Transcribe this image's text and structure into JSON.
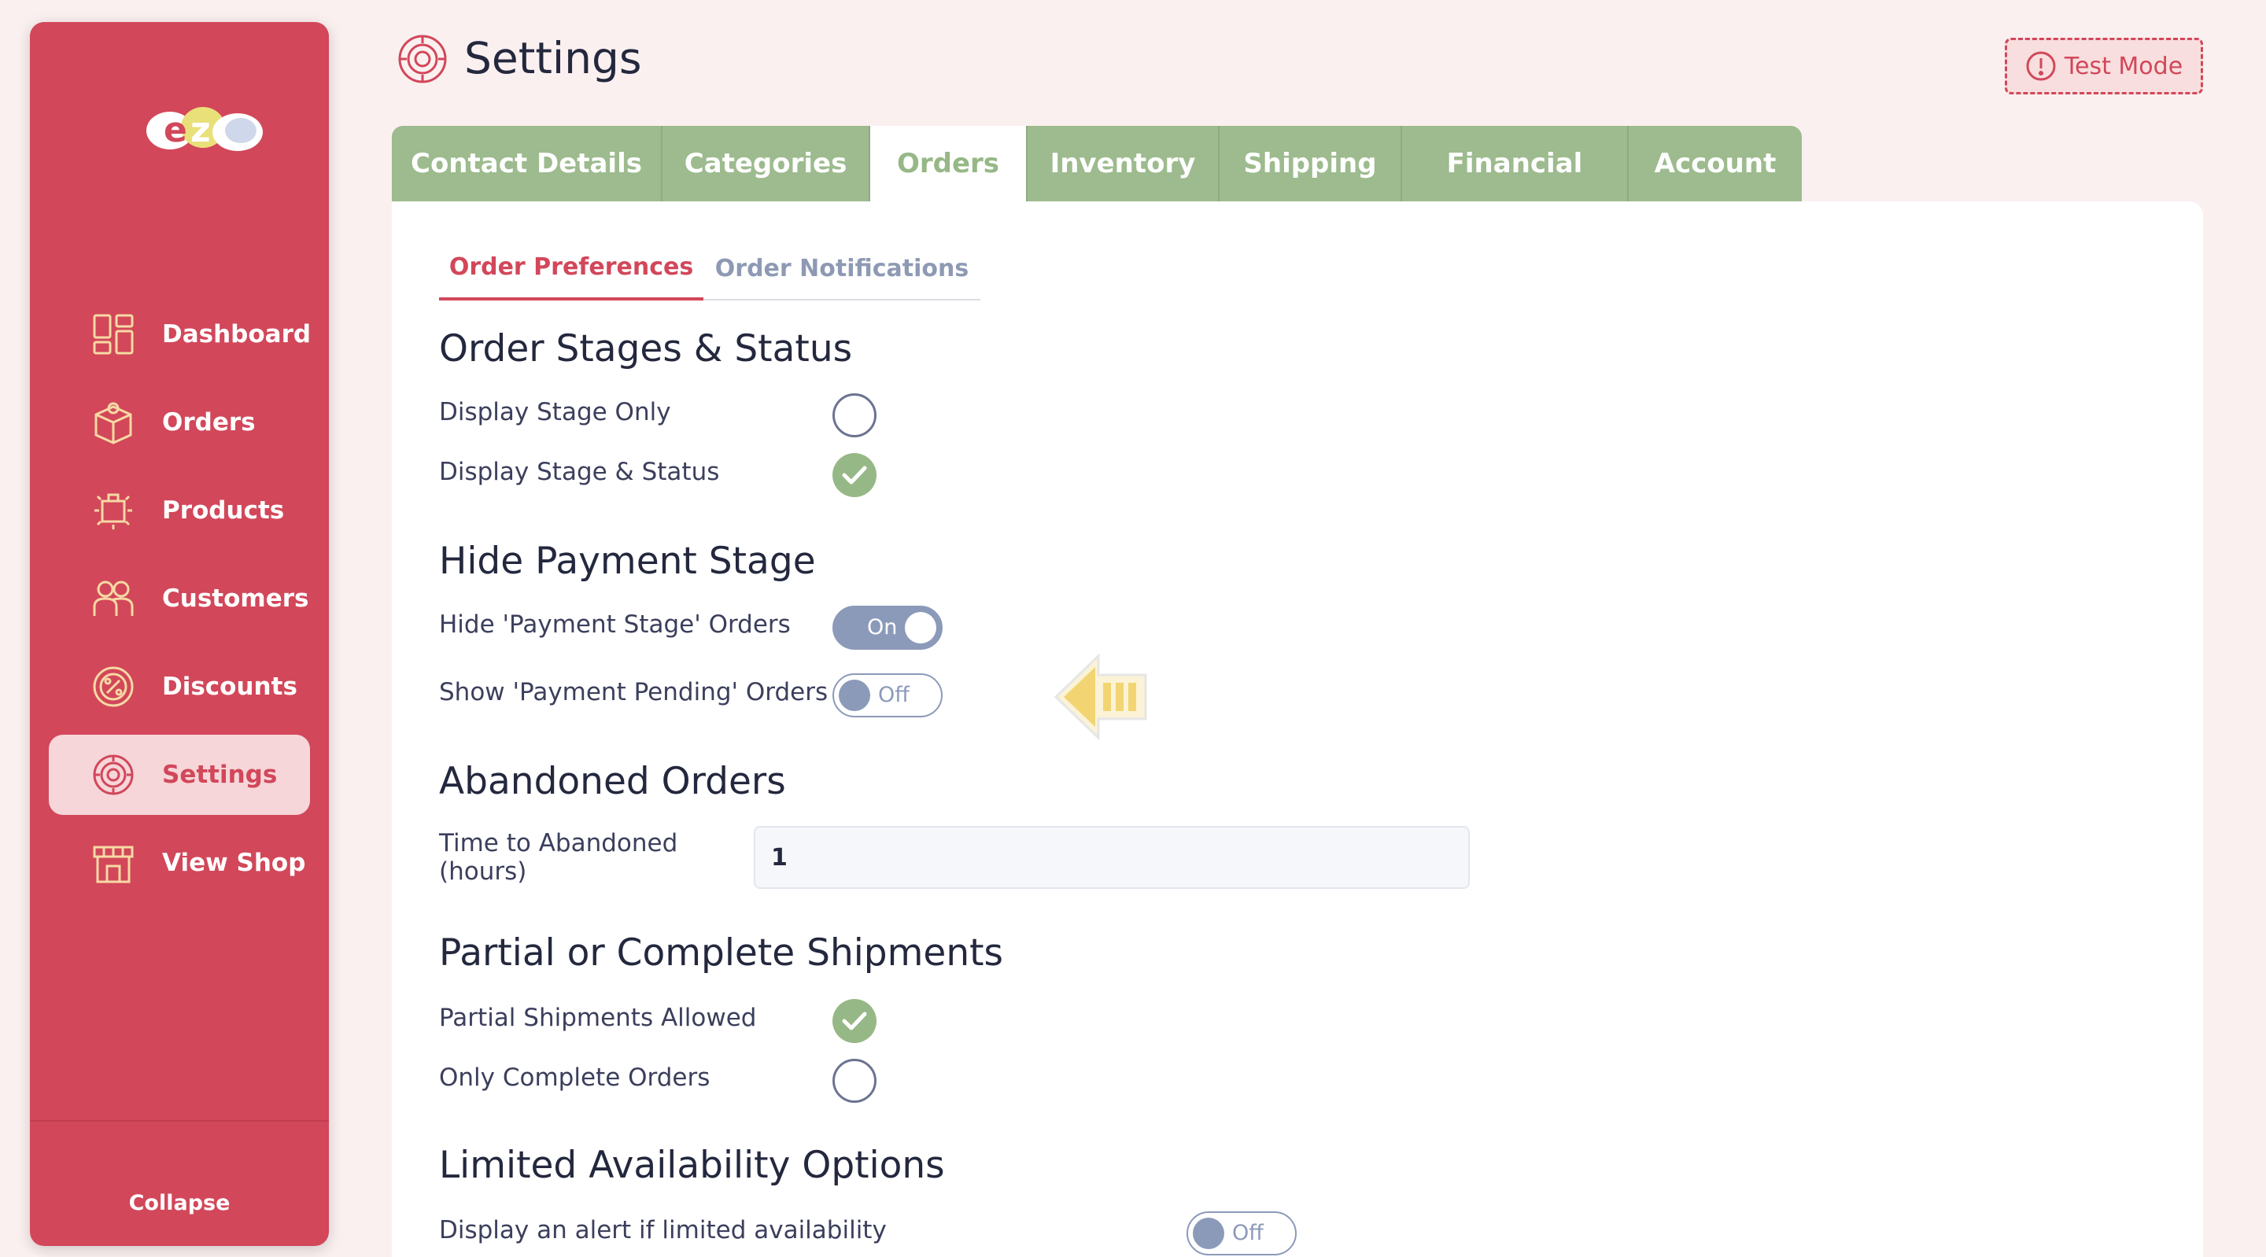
{
  "app": {
    "logo_text": "eZo"
  },
  "sidebar": {
    "items": [
      {
        "label": "Dashboard",
        "icon": "dashboard-icon"
      },
      {
        "label": "Orders",
        "icon": "box-icon"
      },
      {
        "label": "Products",
        "icon": "product-icon"
      },
      {
        "label": "Customers",
        "icon": "customers-icon"
      },
      {
        "label": "Discounts",
        "icon": "percent-icon"
      },
      {
        "label": "Settings",
        "icon": "gear-icon",
        "active": true
      },
      {
        "label": "View Shop",
        "icon": "shop-icon"
      }
    ],
    "collapse_label": "Collapse"
  },
  "header": {
    "title": "Settings",
    "test_mode_label": "Test Mode"
  },
  "tabs": [
    {
      "label": "Contact Details"
    },
    {
      "label": "Categories"
    },
    {
      "label": "Orders",
      "active": true
    },
    {
      "label": "Inventory"
    },
    {
      "label": "Shipping"
    },
    {
      "label": "Financial"
    },
    {
      "label": "Account"
    }
  ],
  "subtabs": [
    {
      "label": "Order Preferences",
      "active": true
    },
    {
      "label": "Order Notifications"
    }
  ],
  "sections": {
    "stages": {
      "title": "Order Stages & Status",
      "options": [
        {
          "label": "Display Stage Only",
          "checked": false
        },
        {
          "label": "Display Stage & Status",
          "checked": true
        }
      ]
    },
    "payment": {
      "title": "Hide Payment Stage",
      "toggles": [
        {
          "label": "Hide 'Payment Stage' Orders",
          "state": "On"
        },
        {
          "label": "Show 'Payment Pending' Orders",
          "state": "Off"
        }
      ]
    },
    "abandoned": {
      "title": "Abandoned Orders",
      "field_label_line1": "Time to Abandoned",
      "field_label_line2": "(hours)",
      "field_value": "1"
    },
    "shipments": {
      "title": "Partial or Complete Shipments",
      "options": [
        {
          "label": "Partial Shipments Allowed",
          "checked": true
        },
        {
          "label": "Only Complete Orders",
          "checked": false
        }
      ]
    },
    "limited": {
      "title": "Limited Availability Options",
      "toggles": [
        {
          "label": "Display an alert if limited availability",
          "state": "Off"
        }
      ]
    }
  },
  "colors": {
    "sidebar": "#d2475a",
    "accent_green": "#96b886",
    "tab_green": "#9dbb8e",
    "toggle": "#8c9ab9",
    "pointer_arrow": "#f2d572"
  }
}
